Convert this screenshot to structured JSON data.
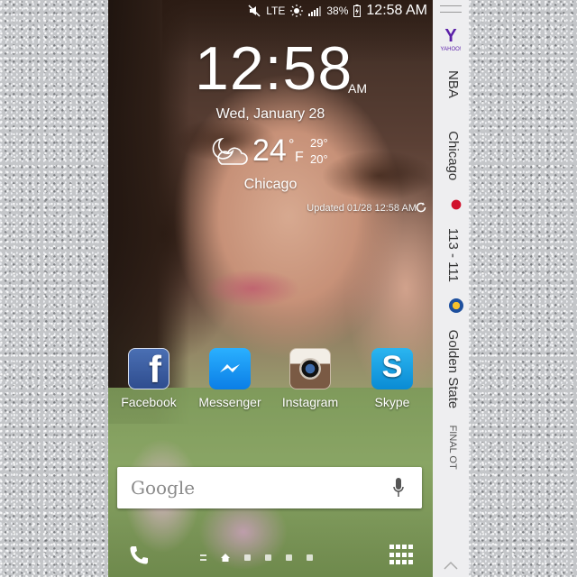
{
  "status_bar": {
    "network": "LTE",
    "battery": "38%",
    "time": "12:58 AM"
  },
  "lockscreen": {
    "clock": "12:58",
    "ampm": "AM",
    "date": "Wed, January 28",
    "weather": {
      "temp": "24",
      "degree": "°",
      "unit": "F",
      "high": "29°",
      "low": "20°",
      "city": "Chicago",
      "updated": "Updated 01/28 12:58 AM",
      "icon": "partly-cloudy-night-icon"
    }
  },
  "apps": [
    {
      "label": "Facebook",
      "icon": "facebook-icon",
      "color": "#3b5998"
    },
    {
      "label": "Messenger",
      "icon": "messenger-icon",
      "color": "#0b84ff"
    },
    {
      "label": "Instagram",
      "icon": "instagram-icon",
      "color": "#7a5a44"
    },
    {
      "label": "Skype",
      "icon": "skype-icon",
      "color": "#00aff0"
    }
  ],
  "search": {
    "placeholder": "Google"
  },
  "edge_panel": {
    "provider": "Y",
    "provider_small": "YAHOO!",
    "league": "NBA",
    "team1": "Chicago",
    "score": "113 - 111",
    "team2": "Golden State",
    "status": "FINAL OT",
    "brand_color": "#5a1fa8"
  }
}
